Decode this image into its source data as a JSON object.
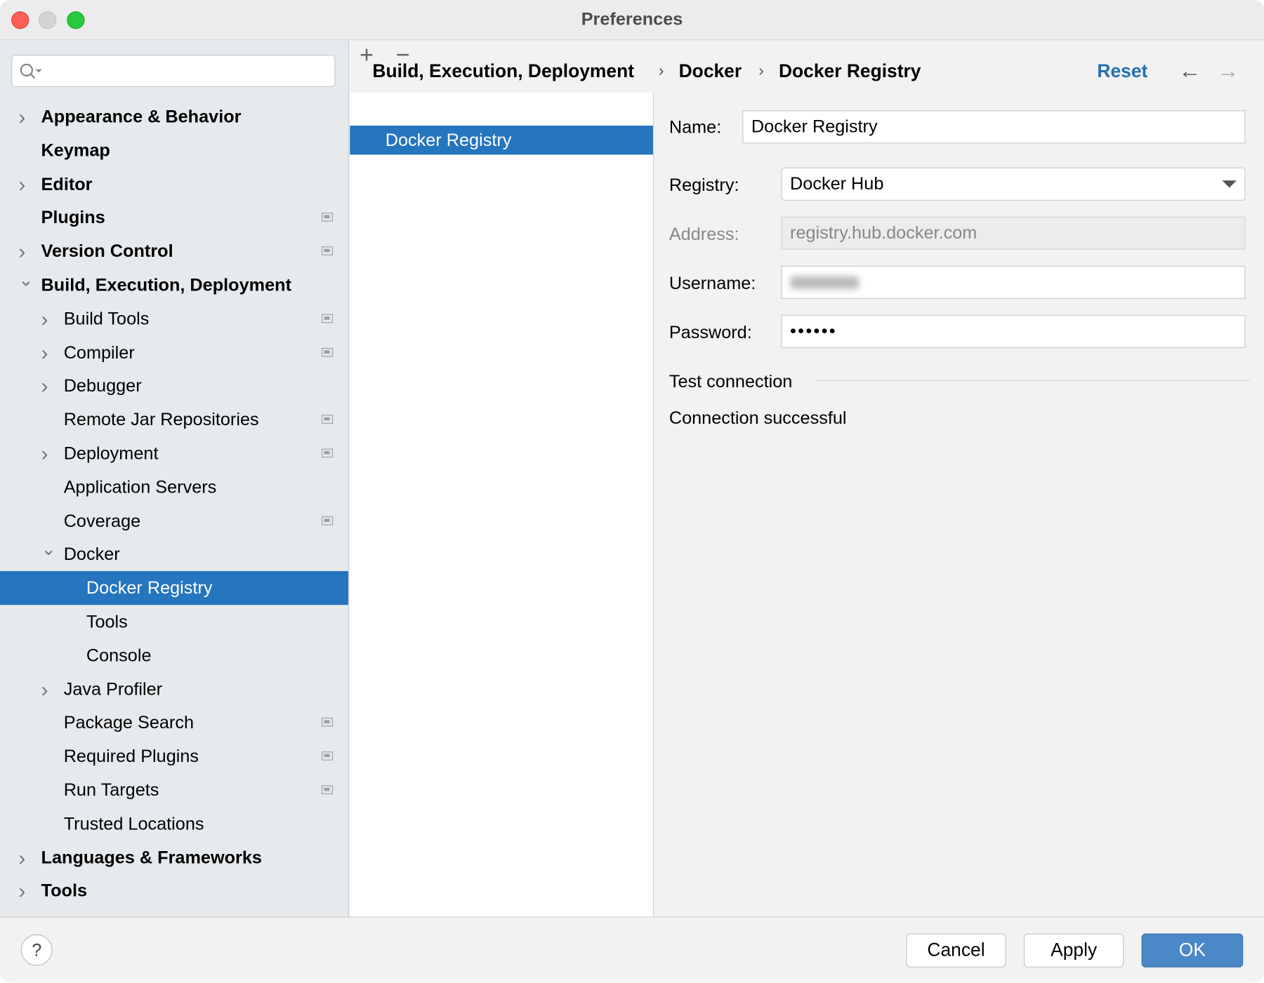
{
  "window": {
    "title": "Preferences"
  },
  "search": {
    "placeholder": ""
  },
  "sidebar": {
    "items": [
      {
        "label": "Appearance & Behavior",
        "level": 0,
        "bold": true,
        "chevron": "right",
        "marker": false
      },
      {
        "label": "Keymap",
        "level": 0,
        "bold": true,
        "chevron": "",
        "marker": false
      },
      {
        "label": "Editor",
        "level": 0,
        "bold": true,
        "chevron": "right",
        "marker": false
      },
      {
        "label": "Plugins",
        "level": 0,
        "bold": true,
        "chevron": "",
        "marker": true
      },
      {
        "label": "Version Control",
        "level": 0,
        "bold": true,
        "chevron": "right",
        "marker": true
      },
      {
        "label": "Build, Execution, Deployment",
        "level": 0,
        "bold": true,
        "chevron": "down",
        "marker": false
      },
      {
        "label": "Build Tools",
        "level": 1,
        "bold": false,
        "chevron": "right",
        "marker": true
      },
      {
        "label": "Compiler",
        "level": 1,
        "bold": false,
        "chevron": "right",
        "marker": true
      },
      {
        "label": "Debugger",
        "level": 1,
        "bold": false,
        "chevron": "right",
        "marker": false
      },
      {
        "label": "Remote Jar Repositories",
        "level": 1,
        "bold": false,
        "chevron": "",
        "marker": true
      },
      {
        "label": "Deployment",
        "level": 1,
        "bold": false,
        "chevron": "right",
        "marker": true
      },
      {
        "label": "Application Servers",
        "level": 1,
        "bold": false,
        "chevron": "",
        "marker": false
      },
      {
        "label": "Coverage",
        "level": 1,
        "bold": false,
        "chevron": "",
        "marker": true
      },
      {
        "label": "Docker",
        "level": 1,
        "bold": false,
        "chevron": "down",
        "marker": false
      },
      {
        "label": "Docker Registry",
        "level": 2,
        "bold": false,
        "chevron": "",
        "marker": false,
        "selected": true
      },
      {
        "label": "Tools",
        "level": 2,
        "bold": false,
        "chevron": "",
        "marker": false
      },
      {
        "label": "Console",
        "level": 2,
        "bold": false,
        "chevron": "",
        "marker": false
      },
      {
        "label": "Java Profiler",
        "level": 1,
        "bold": false,
        "chevron": "right",
        "marker": false
      },
      {
        "label": "Package Search",
        "level": 1,
        "bold": false,
        "chevron": "",
        "marker": true
      },
      {
        "label": "Required Plugins",
        "level": 1,
        "bold": false,
        "chevron": "",
        "marker": true
      },
      {
        "label": "Run Targets",
        "level": 1,
        "bold": false,
        "chevron": "",
        "marker": true
      },
      {
        "label": "Trusted Locations",
        "level": 1,
        "bold": false,
        "chevron": "",
        "marker": false
      },
      {
        "label": "Languages & Frameworks",
        "level": 0,
        "bold": true,
        "chevron": "right",
        "marker": false
      },
      {
        "label": "Tools",
        "level": 0,
        "bold": true,
        "chevron": "right",
        "marker": false
      }
    ]
  },
  "breadcrumb": [
    "Build, Execution, Deployment",
    "Docker",
    "Docker Registry"
  ],
  "header": {
    "reset": "Reset",
    "back": "←",
    "forward": "→"
  },
  "list": {
    "add": "+",
    "remove": "−",
    "items": [
      "Docker Registry"
    ]
  },
  "form": {
    "name_label": "Name:",
    "name_value": "Docker Registry",
    "registry_label": "Registry:",
    "registry_value": "Docker Hub",
    "address_label": "Address:",
    "address_value": "registry.hub.docker.com",
    "username_label": "Username:",
    "password_label": "Password:",
    "password_value": "••••••",
    "test_section": "Test connection",
    "status": "Connection successful"
  },
  "footer": {
    "help": "?",
    "cancel": "Cancel",
    "apply": "Apply",
    "ok": "OK"
  },
  "colors": {
    "accent": "#2675bf",
    "ok_button": "#4a88c7",
    "link": "#2470b3"
  }
}
